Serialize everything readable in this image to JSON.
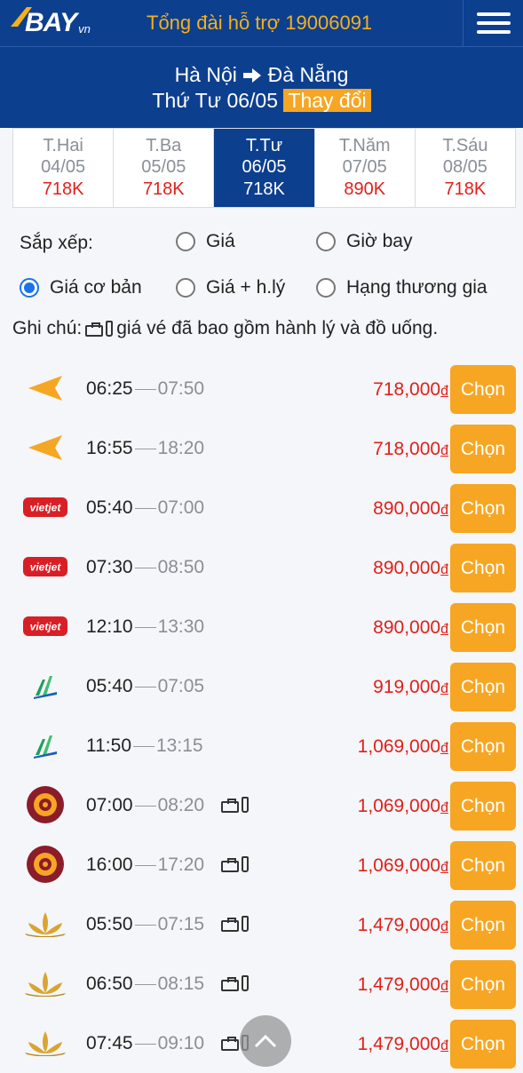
{
  "header": {
    "logo_text": "BAY",
    "logo_suffix": "vn",
    "hotline": "Tổng đài hỗ trợ 19006091",
    "menu_icon": "hamburger-menu-icon"
  },
  "route": {
    "from": "Hà Nội",
    "to": "Đà Nẵng",
    "arrow_icon": "arrow-right-icon",
    "date": "Thứ Tư 06/05",
    "change_label": "Thay đổi"
  },
  "days": [
    {
      "name": "T.Hai",
      "date": "04/05",
      "price": "718K",
      "active": false
    },
    {
      "name": "T.Ba",
      "date": "05/05",
      "price": "718K",
      "active": false
    },
    {
      "name": "T.Tư",
      "date": "06/05",
      "price": "718K",
      "active": true
    },
    {
      "name": "T.Năm",
      "date": "07/05",
      "price": "890K",
      "active": false
    },
    {
      "name": "T.Sáu",
      "date": "08/05",
      "price": "718K",
      "active": false
    }
  ],
  "sort": {
    "label": "Sắp xếp:",
    "options": [
      {
        "label": "Giá",
        "checked": false
      },
      {
        "label": "Giờ bay",
        "checked": false
      },
      {
        "label": "Giá cơ bản",
        "checked": true
      },
      {
        "label": "Giá + h.lý",
        "checked": false
      },
      {
        "label": "Hạng thương gia",
        "checked": false
      }
    ]
  },
  "note": {
    "prefix": "Ghi chú:",
    "text": "giá vé đã bao gồm hành lý và đồ uống."
  },
  "flights": [
    {
      "airline": "jetstar",
      "dep": "06:25",
      "arr": "07:50",
      "bag": false,
      "price": "718,000",
      "currency": "đ",
      "button": "Chọn"
    },
    {
      "airline": "jetstar",
      "dep": "16:55",
      "arr": "18:20",
      "bag": false,
      "price": "718,000",
      "currency": "đ",
      "button": "Chọn"
    },
    {
      "airline": "vietjet",
      "dep": "05:40",
      "arr": "07:00",
      "bag": false,
      "price": "890,000",
      "currency": "đ",
      "button": "Chọn"
    },
    {
      "airline": "vietjet",
      "dep": "07:30",
      "arr": "08:50",
      "bag": false,
      "price": "890,000",
      "currency": "đ",
      "button": "Chọn"
    },
    {
      "airline": "vietjet",
      "dep": "12:10",
      "arr": "13:30",
      "bag": false,
      "price": "890,000",
      "currency": "đ",
      "button": "Chọn"
    },
    {
      "airline": "bamboo",
      "dep": "05:40",
      "arr": "07:05",
      "bag": false,
      "price": "919,000",
      "currency": "đ",
      "button": "Chọn"
    },
    {
      "airline": "bamboo",
      "dep": "11:50",
      "arr": "13:15",
      "bag": false,
      "price": "1,069,000",
      "currency": "đ",
      "button": "Chọn"
    },
    {
      "airline": "vietravel",
      "dep": "07:00",
      "arr": "08:20",
      "bag": true,
      "price": "1,069,000",
      "currency": "đ",
      "button": "Chọn"
    },
    {
      "airline": "vietravel",
      "dep": "16:00",
      "arr": "17:20",
      "bag": true,
      "price": "1,069,000",
      "currency": "đ",
      "button": "Chọn"
    },
    {
      "airline": "vietnam-airlines",
      "dep": "05:50",
      "arr": "07:15",
      "bag": true,
      "price": "1,479,000",
      "currency": "đ",
      "button": "Chọn"
    },
    {
      "airline": "vietnam-airlines",
      "dep": "06:50",
      "arr": "08:15",
      "bag": true,
      "price": "1,479,000",
      "currency": "đ",
      "button": "Chọn"
    },
    {
      "airline": "vietnam-airlines",
      "dep": "07:45",
      "arr": "09:10",
      "bag": true,
      "price": "1,479,000",
      "currency": "đ",
      "button": "Chọn"
    }
  ],
  "scroll_top_icon": "chevron-up-icon",
  "colors": {
    "brand_blue": "#0d3f8f",
    "accent_orange": "#f6a623",
    "price_red": "#e0201b",
    "radio_blue": "#1a73e8"
  }
}
